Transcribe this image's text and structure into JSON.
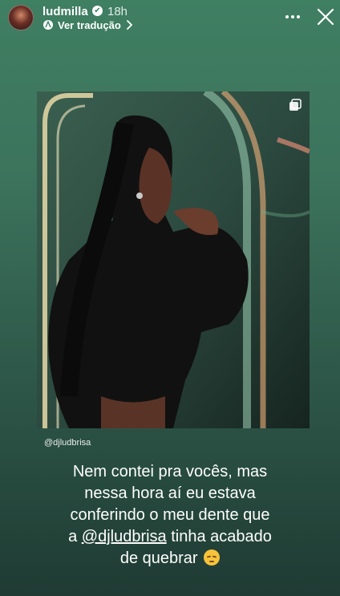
{
  "header": {
    "username": "ludmilla",
    "verified_mark": "✔",
    "time": "18h",
    "translate_label": "Ver tradução",
    "more_icon": "more-dots-icon",
    "close_icon": "close-icon"
  },
  "story": {
    "photo_icon": "multiple-photos-icon",
    "credit": "@djludbrisa",
    "caption": {
      "line1": "Nem contei pra vocês, mas",
      "line2": "nessa hora aí eu estava",
      "line3": "conferindo o meu dente que",
      "line4_prefix": "a ",
      "mention": "@djludbrisa",
      "line4_suffix": " tinha acabado",
      "line5": "de quebrar",
      "emoji": "unamused-face-emoji"
    }
  },
  "colors": {
    "background_top": "#3f7f62",
    "background_bottom": "#1f3b33",
    "text": "#ffffff"
  }
}
